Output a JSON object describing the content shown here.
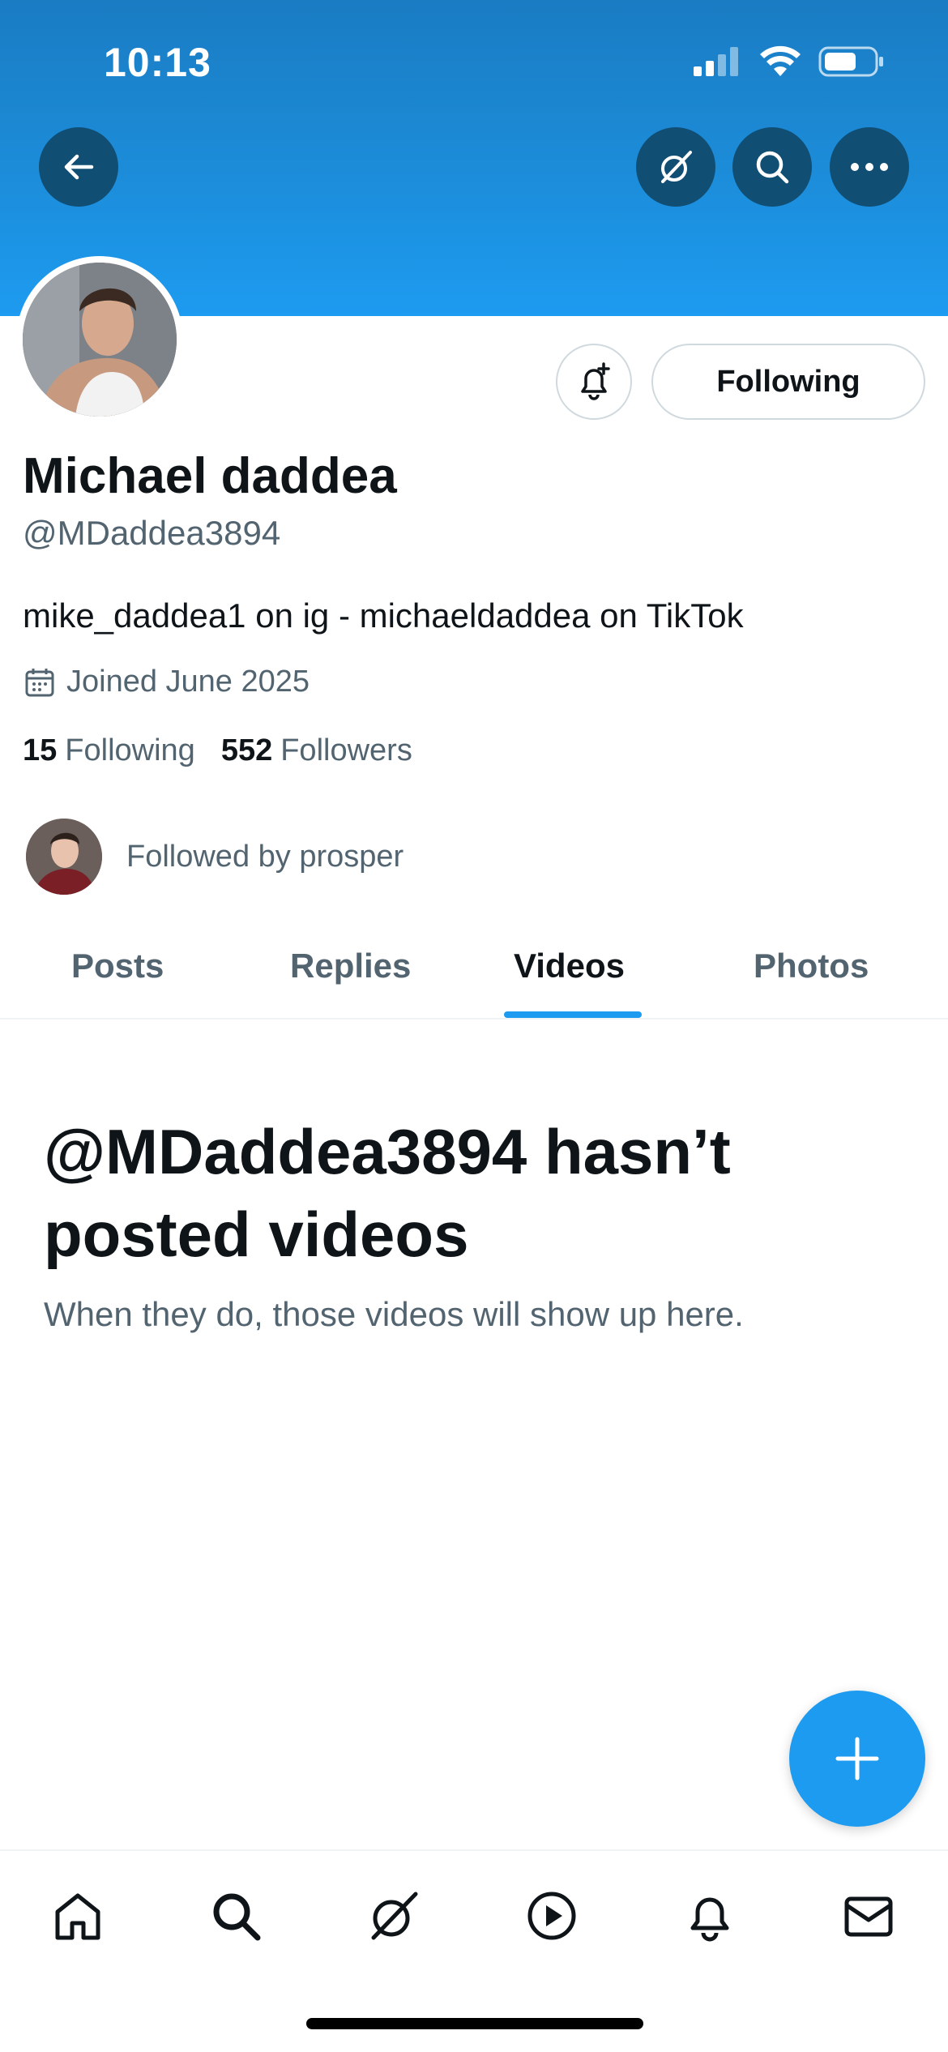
{
  "status_bar": {
    "time": "10:13"
  },
  "profile": {
    "display_name": "Michael daddea",
    "handle": "@MDaddea3894",
    "bio": "mike_daddea1 on ig - michaeldaddea on TikTok",
    "joined": "Joined June 2025",
    "following_count": "15",
    "following_label": "Following",
    "followers_count": "552",
    "followers_label": "Followers",
    "followed_by": "Followed by prosper",
    "follow_button_label": "Following"
  },
  "tabs": [
    {
      "label": "Posts",
      "active": false
    },
    {
      "label": "Replies",
      "active": false
    },
    {
      "label": "Videos",
      "active": true
    },
    {
      "label": "Photos",
      "active": false
    }
  ],
  "empty_state": {
    "title": "@MDaddea3894 hasn’t posted videos",
    "subtitle": "When they do, those videos will show up here."
  },
  "icons": {
    "header": [
      "back-arrow-icon",
      "grok-icon",
      "search-icon",
      "more-icon"
    ],
    "bottom_nav": [
      "home-icon",
      "search-icon",
      "grok-icon",
      "video-icon",
      "notifications-icon",
      "messages-icon"
    ]
  },
  "colors": {
    "accent": "#1d9bf0",
    "banner": "#1c8bd7",
    "text": "#0f1419",
    "muted": "#536471"
  }
}
